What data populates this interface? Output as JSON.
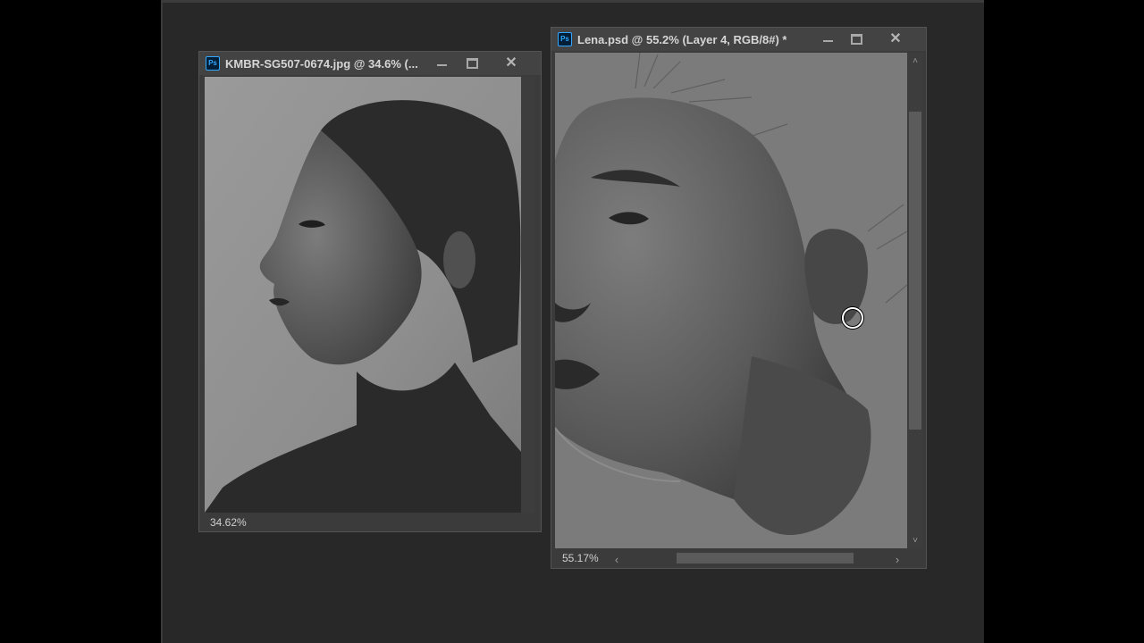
{
  "windows": [
    {
      "title": "KMBR-SG507-0674.jpg @ 34.6% (...",
      "app_icon": "Ps",
      "zoom_status": "34.62%",
      "controls": {
        "minimize": "minimize-icon",
        "maximize": "maximize-icon",
        "close": "close-icon"
      }
    },
    {
      "title": "Lena.psd @ 55.2% (Layer 4, RGB/8#) *",
      "app_icon": "Ps",
      "zoom_status": "55.17%",
      "controls": {
        "minimize": "minimize-icon",
        "maximize": "maximize-icon",
        "close": "close-icon"
      },
      "scroll": {
        "up_arrow": "˄",
        "down_arrow": "˅",
        "left_arrow": "‹",
        "right_arrow": "›"
      }
    }
  ],
  "cursor": {
    "tool": "brush-cursor-icon"
  },
  "colors": {
    "workspace": "#282828",
    "panel": "#3b3b3b",
    "accent": "#31a8ff"
  }
}
